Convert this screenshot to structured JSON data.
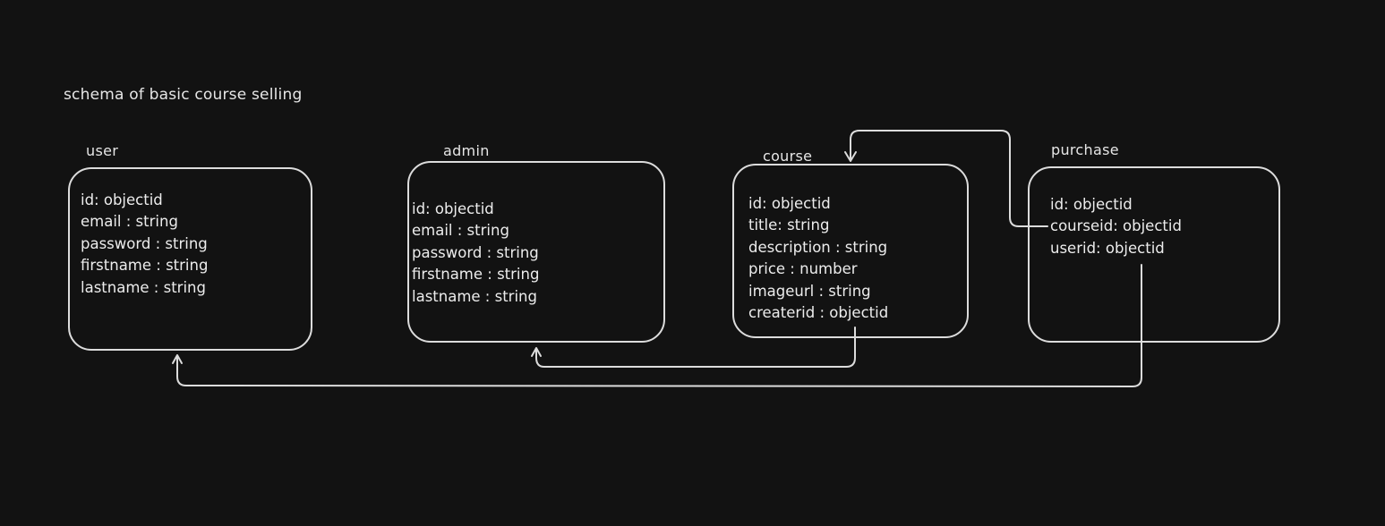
{
  "title": "schema of basic course selling",
  "entities": {
    "user": {
      "label": "user",
      "fields": [
        "id: objectid",
        "email : string",
        "password : string",
        "firstname : string",
        "lastname : string"
      ]
    },
    "admin": {
      "label": "admin",
      "fields": [
        "id: objectid",
        "email : string",
        "password : string",
        "firstname : string",
        "lastname : string"
      ]
    },
    "course": {
      "label": "course",
      "fields": [
        "id: objectid",
        "title: string",
        "description : string",
        "price : number",
        "imageurl : string",
        "createrid : objectid"
      ]
    },
    "purchase": {
      "label": "purchase",
      "fields": [
        "id: objectid",
        "courseid: objectid",
        "userid: objectid"
      ]
    }
  },
  "relations": [
    {
      "from": "course.createrid",
      "to": "admin"
    },
    {
      "from": "purchase.courseid",
      "to": "course"
    },
    {
      "from": "purchase.userid",
      "to": "user"
    }
  ],
  "colors": {
    "background": "#121212",
    "stroke": "#dcdcdc",
    "text": "#e6e6e6"
  }
}
